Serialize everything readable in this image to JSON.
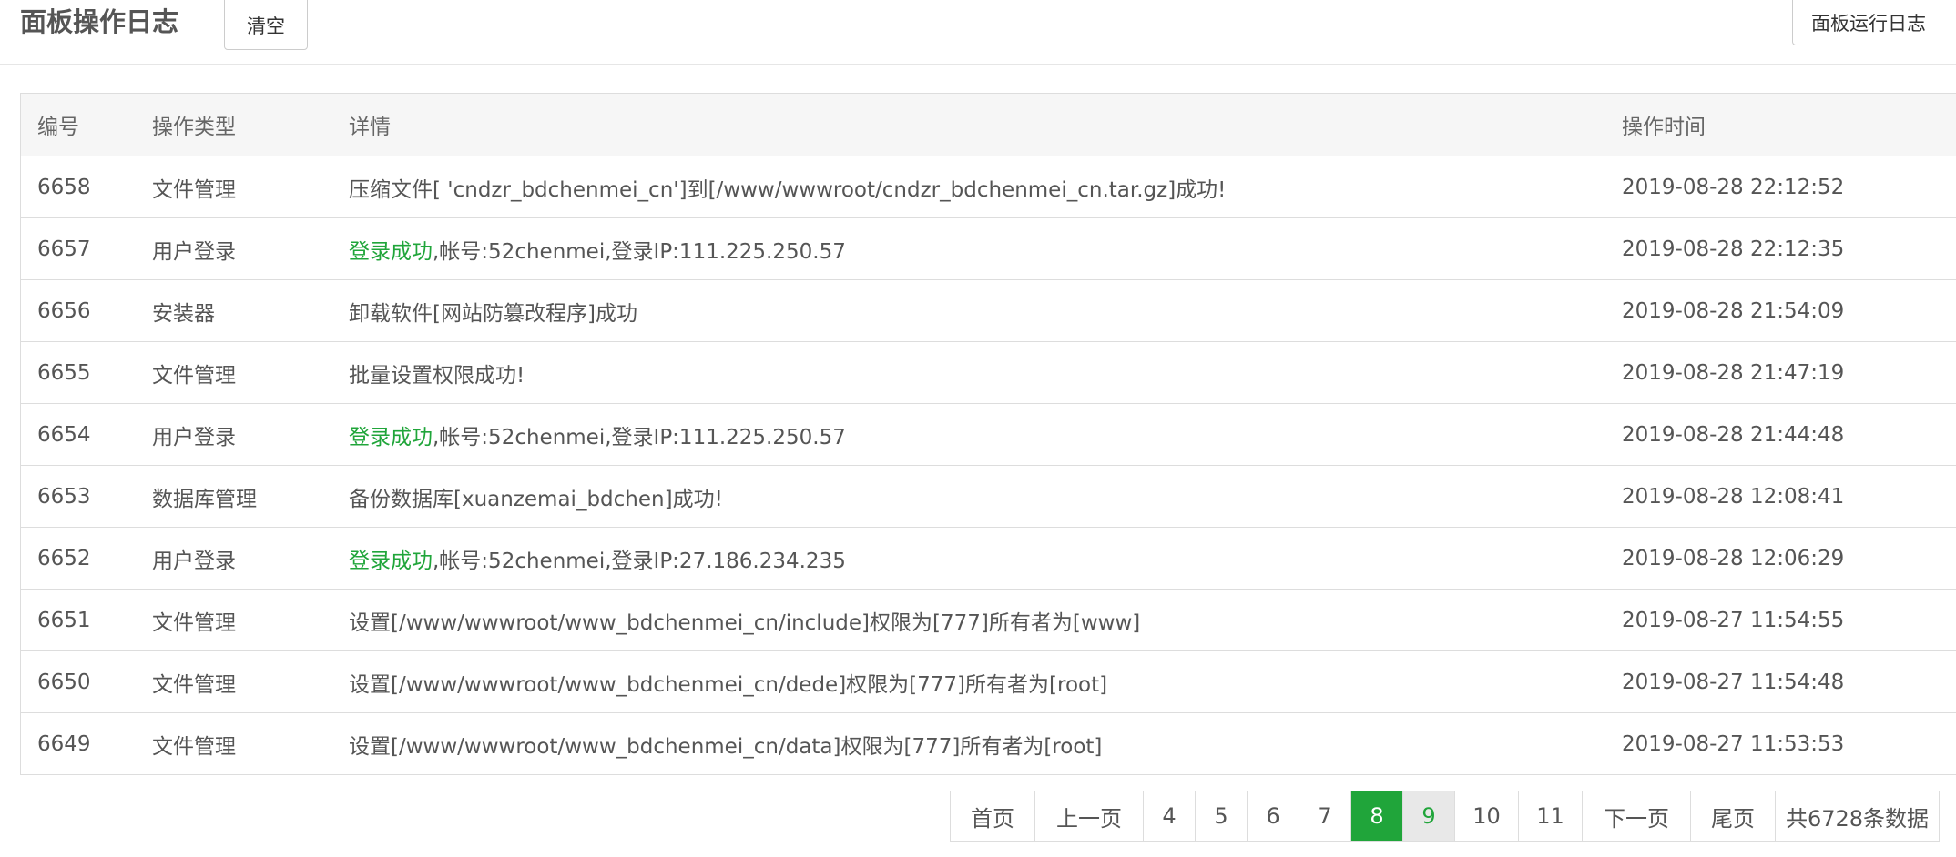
{
  "header": {
    "title": "面板操作日志",
    "clear_label": "清空",
    "run_log_label": "面板运行日志"
  },
  "table": {
    "columns": [
      "编号",
      "操作类型",
      "详情",
      "操作时间"
    ],
    "rows": [
      {
        "id": "6658",
        "type": "文件管理",
        "detail_prefix": "",
        "detail": "压缩文件[ 'cndzr_bdchenmei_cn']到[/www/wwwroot/cndzr_bdchenmei_cn.tar.gz]成功!",
        "time": "2019-08-28 22:12:52"
      },
      {
        "id": "6657",
        "type": "用户登录",
        "detail_prefix": "登录成功",
        "detail": ",帐号:52chenmei,登录IP:111.225.250.57",
        "time": "2019-08-28 22:12:35"
      },
      {
        "id": "6656",
        "type": "安装器",
        "detail_prefix": "",
        "detail": "卸载软件[网站防篡改程序]成功",
        "time": "2019-08-28 21:54:09"
      },
      {
        "id": "6655",
        "type": "文件管理",
        "detail_prefix": "",
        "detail": "批量设置权限成功!",
        "time": "2019-08-28 21:47:19"
      },
      {
        "id": "6654",
        "type": "用户登录",
        "detail_prefix": "登录成功",
        "detail": ",帐号:52chenmei,登录IP:111.225.250.57",
        "time": "2019-08-28 21:44:48"
      },
      {
        "id": "6653",
        "type": "数据库管理",
        "detail_prefix": "",
        "detail": "备份数据库[xuanzemai_bdchen]成功!",
        "time": "2019-08-28 12:08:41"
      },
      {
        "id": "6652",
        "type": "用户登录",
        "detail_prefix": "登录成功",
        "detail": ",帐号:52chenmei,登录IP:27.186.234.235",
        "time": "2019-08-28 12:06:29"
      },
      {
        "id": "6651",
        "type": "文件管理",
        "detail_prefix": "",
        "detail": "设置[/www/wwwroot/www_bdchenmei_cn/include]权限为[777]所有者为[www]",
        "time": "2019-08-27 11:54:55"
      },
      {
        "id": "6650",
        "type": "文件管理",
        "detail_prefix": "",
        "detail": "设置[/www/wwwroot/www_bdchenmei_cn/dede]权限为[777]所有者为[root]",
        "time": "2019-08-27 11:54:48"
      },
      {
        "id": "6649",
        "type": "文件管理",
        "detail_prefix": "",
        "detail": "设置[/www/wwwroot/www_bdchenmei_cn/data]权限为[777]所有者为[root]",
        "time": "2019-08-27 11:53:53"
      }
    ]
  },
  "pagination": {
    "first": "首页",
    "prev": "上一页",
    "pages": [
      "4",
      "5",
      "6",
      "7",
      "8",
      "9",
      "10",
      "11"
    ],
    "current": "8",
    "next": "下一页",
    "last": "尾页",
    "total": "共6728条数据"
  },
  "colors": {
    "accent": "#20a53a"
  }
}
